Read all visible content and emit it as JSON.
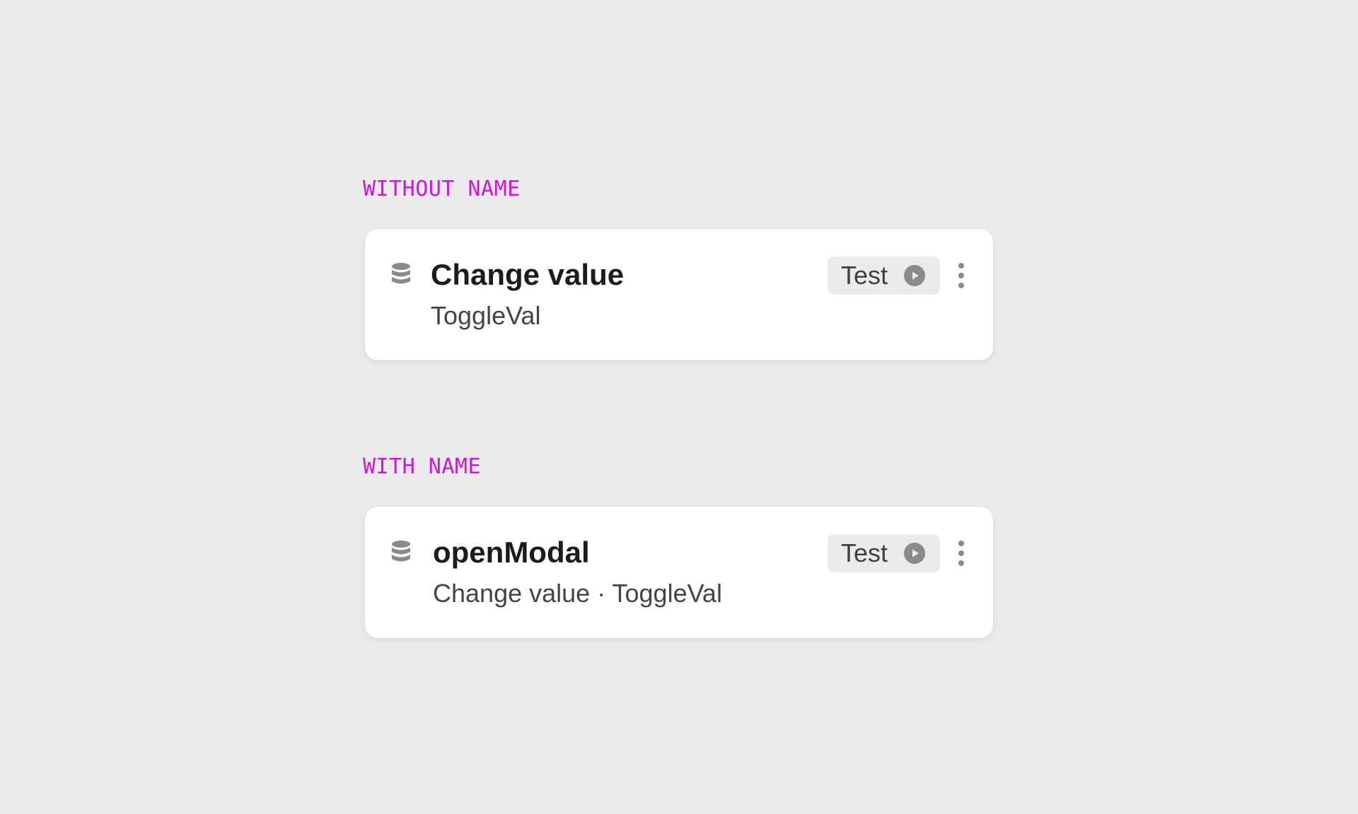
{
  "sections": [
    {
      "label": "WITHOUT NAME",
      "card": {
        "icon": "database-icon",
        "title": "Change value",
        "subtitle": "ToggleVal",
        "test_label": "Test",
        "test_icon": "play-icon",
        "menu_icon": "more-vertical-icon"
      }
    },
    {
      "label": "WITH NAME",
      "card": {
        "icon": "database-icon",
        "title": "openModal",
        "subtitle": "Change value · ToggleVal",
        "test_label": "Test",
        "test_icon": "play-icon",
        "menu_icon": "more-vertical-icon"
      }
    }
  ],
  "colors": {
    "background": "#ebebeb",
    "section_label": "#cc16d8",
    "card": "#ffffff",
    "title": "#1c1c1c",
    "subtitle": "#444444",
    "button_bg": "#ebebeb",
    "icon": "#8a8a8a"
  }
}
